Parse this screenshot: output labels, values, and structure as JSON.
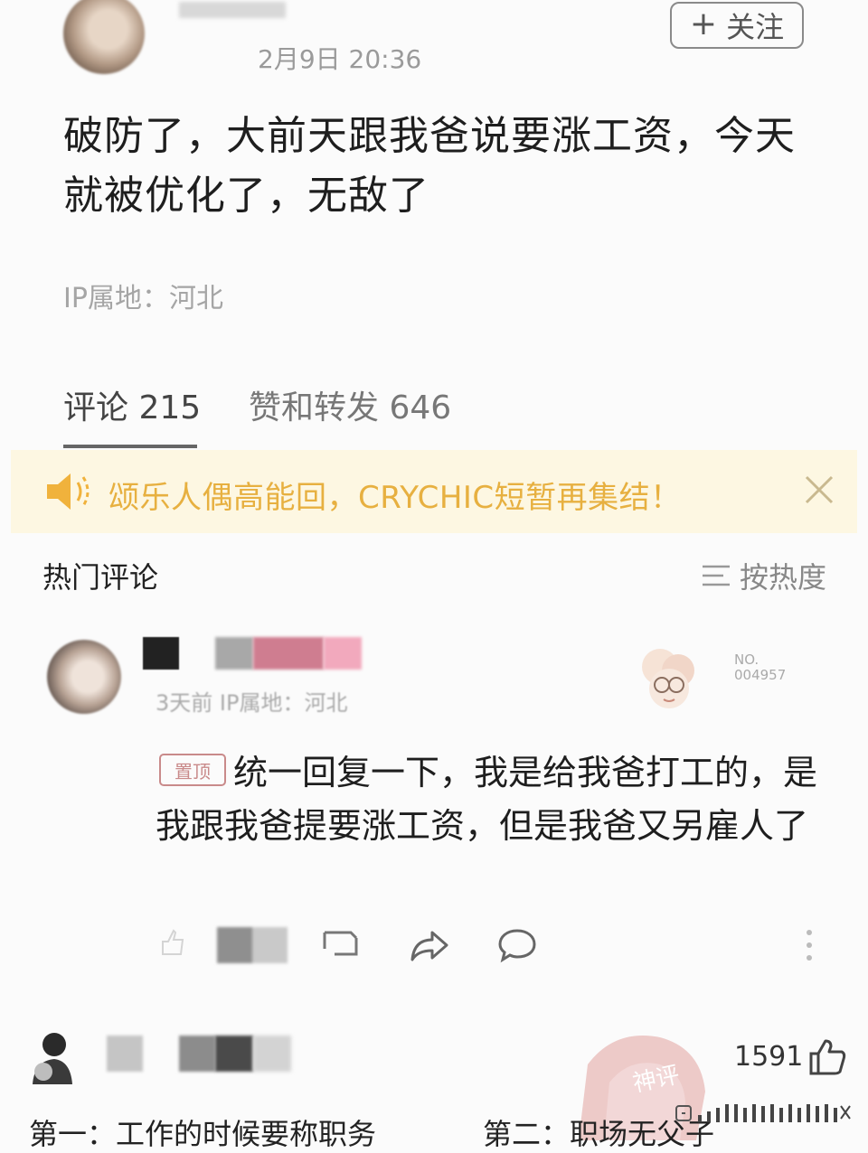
{
  "post": {
    "time": "2月9日 20:36",
    "follow_label": "关注",
    "text": "破防了，大前天跟我爸说要涨工资，今天就被优化了，无敌了",
    "ip": "IP属地：河北"
  },
  "tabs": {
    "comments": "评论 215",
    "likes": "赞和转发 646"
  },
  "banner": {
    "text": "颂乐人偶高能回，CRYCHIC短暂再集结！"
  },
  "hot": {
    "title": "热门评论",
    "sort_label": "按热度"
  },
  "comment1": {
    "meta": "3天前 IP属地：河北",
    "badge_text_1": "NO.",
    "badge_text_2": "004957",
    "pin_label": "置顶",
    "text": "统一回复一下，我是给我爸打工的，是我跟我爸提要涨工资，但是我爸又另雇人了"
  },
  "comment2": {
    "like_count": "1591",
    "text_a": "第一：工作的时候要称职务",
    "text_b": "第二：职场无父子"
  },
  "watermark": {
    "text": "神评"
  },
  "colors": {
    "banner_bg": "#fdf7e2",
    "banner_text": "#e7b040",
    "pin": "#c98a8a"
  }
}
